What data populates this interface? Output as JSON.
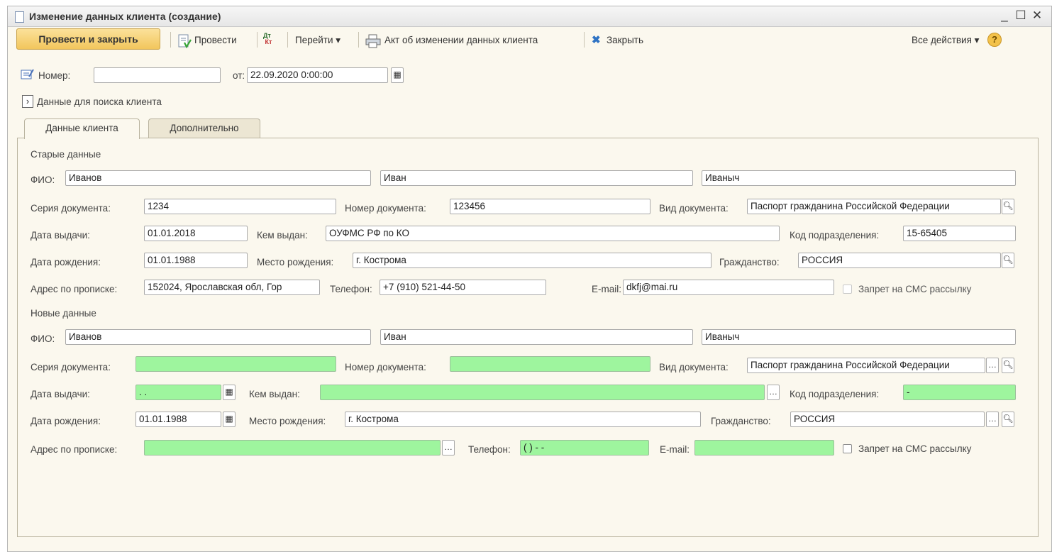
{
  "window": {
    "title": "Изменение данных клиента (создание)"
  },
  "toolbar": {
    "post_close": "Провести и закрыть",
    "post": "Провести",
    "goto": "Перейти",
    "act": "Акт об изменении данных клиента",
    "close": "Закрыть",
    "all_actions": "Все действия"
  },
  "header": {
    "number_label": "Номер:",
    "number_value": "",
    "date_label": "от:",
    "date_value": "22.09.2020  0:00:00",
    "search_group": "Данные для поиска клиента"
  },
  "tabs": [
    "Данные клиента",
    "Дополнительно"
  ],
  "labels": {
    "fio": "ФИО:",
    "doc_series": "Серия документа:",
    "doc_number": "Номер документа:",
    "doc_type": "Вид документа:",
    "issue_date": "Дата выдачи:",
    "issued_by": "Кем выдан:",
    "dept_code": "Код подразделения:",
    "birth_date": "Дата рождения:",
    "birth_place": "Место рождения:",
    "citizenship": "Гражданство:",
    "address": "Адрес по прописке:",
    "phone": "Телефон:",
    "email": "E-mail:",
    "sms": "Запрет на СМС рассылку"
  },
  "old": {
    "section": "Старые данные",
    "last_name": "Иванов",
    "first_name": "Иван",
    "patronymic": "Иваныч",
    "doc_series": "1234",
    "doc_number": "123456",
    "doc_type": "Паспорт гражданина Российской Федерации",
    "issue_date": "01.01.2018",
    "issued_by": "ОУФМС РФ по КО",
    "dept_code": "15-65405",
    "birth_date": "01.01.1988",
    "birth_place": "г. Кострома",
    "citizenship": "РОССИЯ",
    "address": "152024, Ярославская обл, Гор",
    "phone": "+7 (910) 521-44-50",
    "email": "dkfj@mai.ru"
  },
  "new": {
    "section": "Новые данные",
    "last_name": "Иванов",
    "first_name": "Иван",
    "patronymic": "Иваныч",
    "doc_series": "",
    "doc_number": "",
    "doc_type": "Паспорт гражданина Российской Федерации",
    "issue_date": " .  .",
    "issued_by": "",
    "dept_code": " -",
    "birth_date": "01.01.1988",
    "birth_place": "г. Кострома",
    "citizenship": "РОССИЯ",
    "address": "",
    "phone": "  (   )    -  -",
    "email": ""
  },
  "colors": {
    "changed_field": "#9ef59e",
    "primary_button": "#f2c65c",
    "form_bg": "#fbf8ee"
  }
}
